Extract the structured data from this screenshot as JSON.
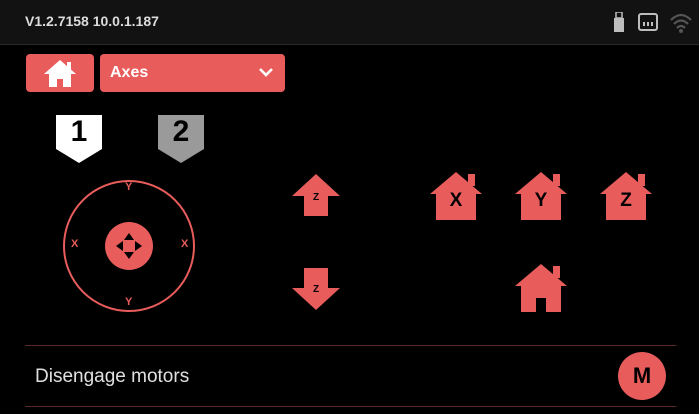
{
  "status_bar": {
    "version": "V1.2.7158  10.0.1.187",
    "icons": [
      "usb-icon",
      "sd-card-icon",
      "wifi-icon"
    ]
  },
  "toolbar": {
    "home_icon": "home-icon",
    "select_value": "Axes"
  },
  "tool_tabs": [
    {
      "label": "1",
      "state": "active"
    },
    {
      "label": "2",
      "state": "inactive"
    }
  ],
  "joystick": {
    "top_label": "Y",
    "bottom_label": "Y",
    "left_label": "X",
    "right_label": "X"
  },
  "z_buttons": {
    "up_label": "Z",
    "down_label": "Z"
  },
  "home_axes": [
    {
      "label": "X"
    },
    {
      "label": "Y"
    },
    {
      "label": "Z"
    }
  ],
  "disengage": {
    "label": "Disengage motors",
    "button_label": "M"
  },
  "colors": {
    "accent": "#e85c5c",
    "background": "#000000",
    "inactive": "#9a9a9a"
  }
}
